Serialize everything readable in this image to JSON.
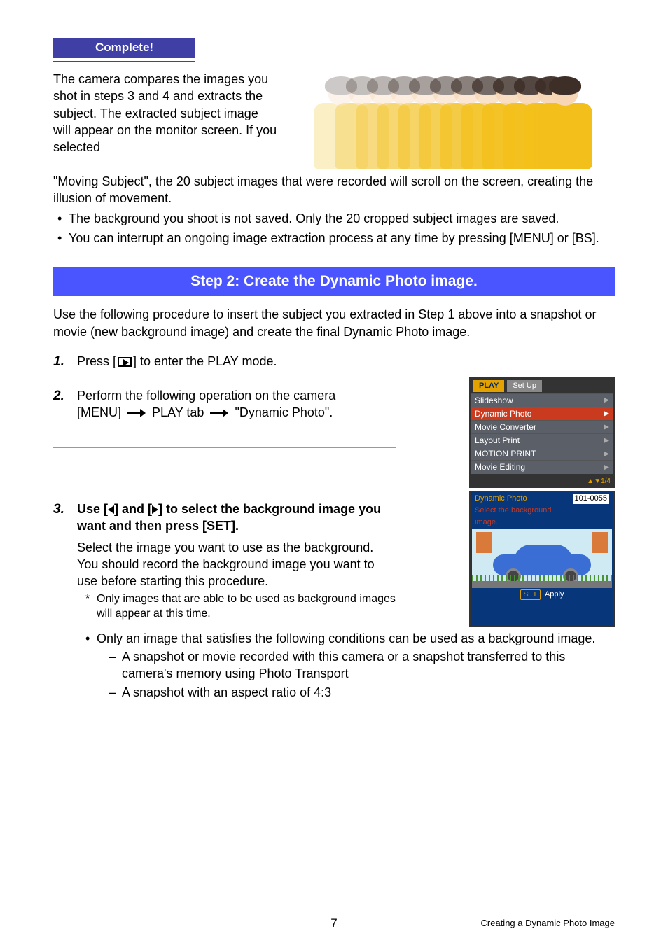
{
  "complete_label": "Complete!",
  "para1a": "The camera compares the images you shot in steps 3 and 4 and extracts the subject. The extracted subject image will appear on the monitor screen. If you selected",
  "para1b": "\"Moving Subject\", the 20 subject images that were recorded will scroll on the screen, creating the illusion of movement.",
  "bullets1": {
    "b1": "The background you shoot is not saved. Only the 20 cropped subject images are saved.",
    "b2": "You can interrupt an ongoing image extraction process at any time by pressing [MENU] or [BS]."
  },
  "step_bar": "Step 2: Create the Dynamic Photo image.",
  "para2": "Use the following procedure to insert the subject you extracted in Step 1 above into a snapshot or movie (new background image) and create the final Dynamic Photo image.",
  "steps": {
    "s1": {
      "num": "1.",
      "pre": "Press [",
      "post": "] to enter the PLAY mode."
    },
    "s2": {
      "num": "2.",
      "line1": "Perform the following operation on the camera",
      "line2a": "[MENU] ",
      "line2b": " PLAY tab ",
      "line2c": " \"Dynamic Photo\"."
    },
    "s3": {
      "num": "3.",
      "bold_a": "Use [",
      "bold_b": "] and [",
      "bold_c": "] to select the background image you want and then press [SET].",
      "sub1": "Select the image you want to use as the background.",
      "sub2": "You should record the background image you want to use before starting this procedure.",
      "star": "Only images that are able to be used as background images will appear at this time.",
      "ib1": "Only an image that satisfies the following conditions can be used as a background image.",
      "d1": "A snapshot or movie recorded with this camera or a snapshot transferred to this camera's memory using Photo Transport",
      "d2": "A snapshot with an aspect ratio of 4:3"
    }
  },
  "menu": {
    "tab_play": "PLAY",
    "tab_setup": "Set Up",
    "items": {
      "i0": "Slideshow",
      "i1": "Dynamic Photo",
      "i2": "Movie Converter",
      "i3": "Layout Print",
      "i4": "MOTION PRINT",
      "i5": "Movie Editing"
    },
    "page": "▲▼1/4"
  },
  "bgshot": {
    "title": "Dynamic Photo",
    "file": "101-0055",
    "msg1": "Select the  background",
    "msg2": "image.",
    "set": "SET",
    "apply": "Apply"
  },
  "footer": {
    "page": "7",
    "section": "Creating a Dynamic Photo Image"
  }
}
